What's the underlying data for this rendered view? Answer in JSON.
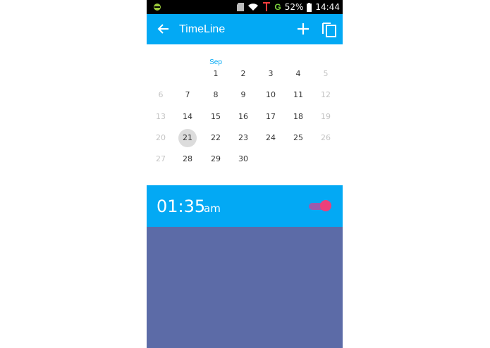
{
  "statusbar": {
    "battery_percent": "52%",
    "time": "14:44",
    "network": "G",
    "icons": [
      "android-debug-icon",
      "sd-card-icon",
      "wifi-icon",
      "signal-icon",
      "battery-icon"
    ]
  },
  "appbar": {
    "title": "TimeLine",
    "icons": [
      "back-arrow-icon",
      "add-icon",
      "copy-icon"
    ],
    "color": "#03a9f4"
  },
  "calendar": {
    "month_label": "Sep",
    "selected_day": "21",
    "weeks": [
      [
        {
          "d": "",
          "dim": false
        },
        {
          "d": "",
          "dim": false
        },
        {
          "d": "1",
          "dim": false
        },
        {
          "d": "2",
          "dim": false
        },
        {
          "d": "3",
          "dim": false
        },
        {
          "d": "4",
          "dim": false
        },
        {
          "d": "5",
          "dim": true
        }
      ],
      [
        {
          "d": "6",
          "dim": true
        },
        {
          "d": "7",
          "dim": false
        },
        {
          "d": "8",
          "dim": false
        },
        {
          "d": "9",
          "dim": false
        },
        {
          "d": "10",
          "dim": false
        },
        {
          "d": "11",
          "dim": false
        },
        {
          "d": "12",
          "dim": true
        }
      ],
      [
        {
          "d": "13",
          "dim": true
        },
        {
          "d": "14",
          "dim": false
        },
        {
          "d": "15",
          "dim": false
        },
        {
          "d": "16",
          "dim": false
        },
        {
          "d": "17",
          "dim": false
        },
        {
          "d": "18",
          "dim": false
        },
        {
          "d": "19",
          "dim": true
        }
      ],
      [
        {
          "d": "20",
          "dim": true
        },
        {
          "d": "21",
          "dim": false
        },
        {
          "d": "22",
          "dim": false
        },
        {
          "d": "23",
          "dim": false
        },
        {
          "d": "24",
          "dim": false
        },
        {
          "d": "25",
          "dim": false
        },
        {
          "d": "26",
          "dim": true
        }
      ],
      [
        {
          "d": "27",
          "dim": true
        },
        {
          "d": "28",
          "dim": false
        },
        {
          "d": "29",
          "dim": false
        },
        {
          "d": "30",
          "dim": false
        },
        {
          "d": "",
          "dim": false
        },
        {
          "d": "",
          "dim": false
        },
        {
          "d": "",
          "dim": false
        }
      ]
    ]
  },
  "alarm": {
    "time": "01:35",
    "ampm": "am",
    "enabled": true,
    "accent": "#ec407a"
  },
  "colors": {
    "primary": "#03a9f4",
    "panel": "#5c6ba7"
  }
}
